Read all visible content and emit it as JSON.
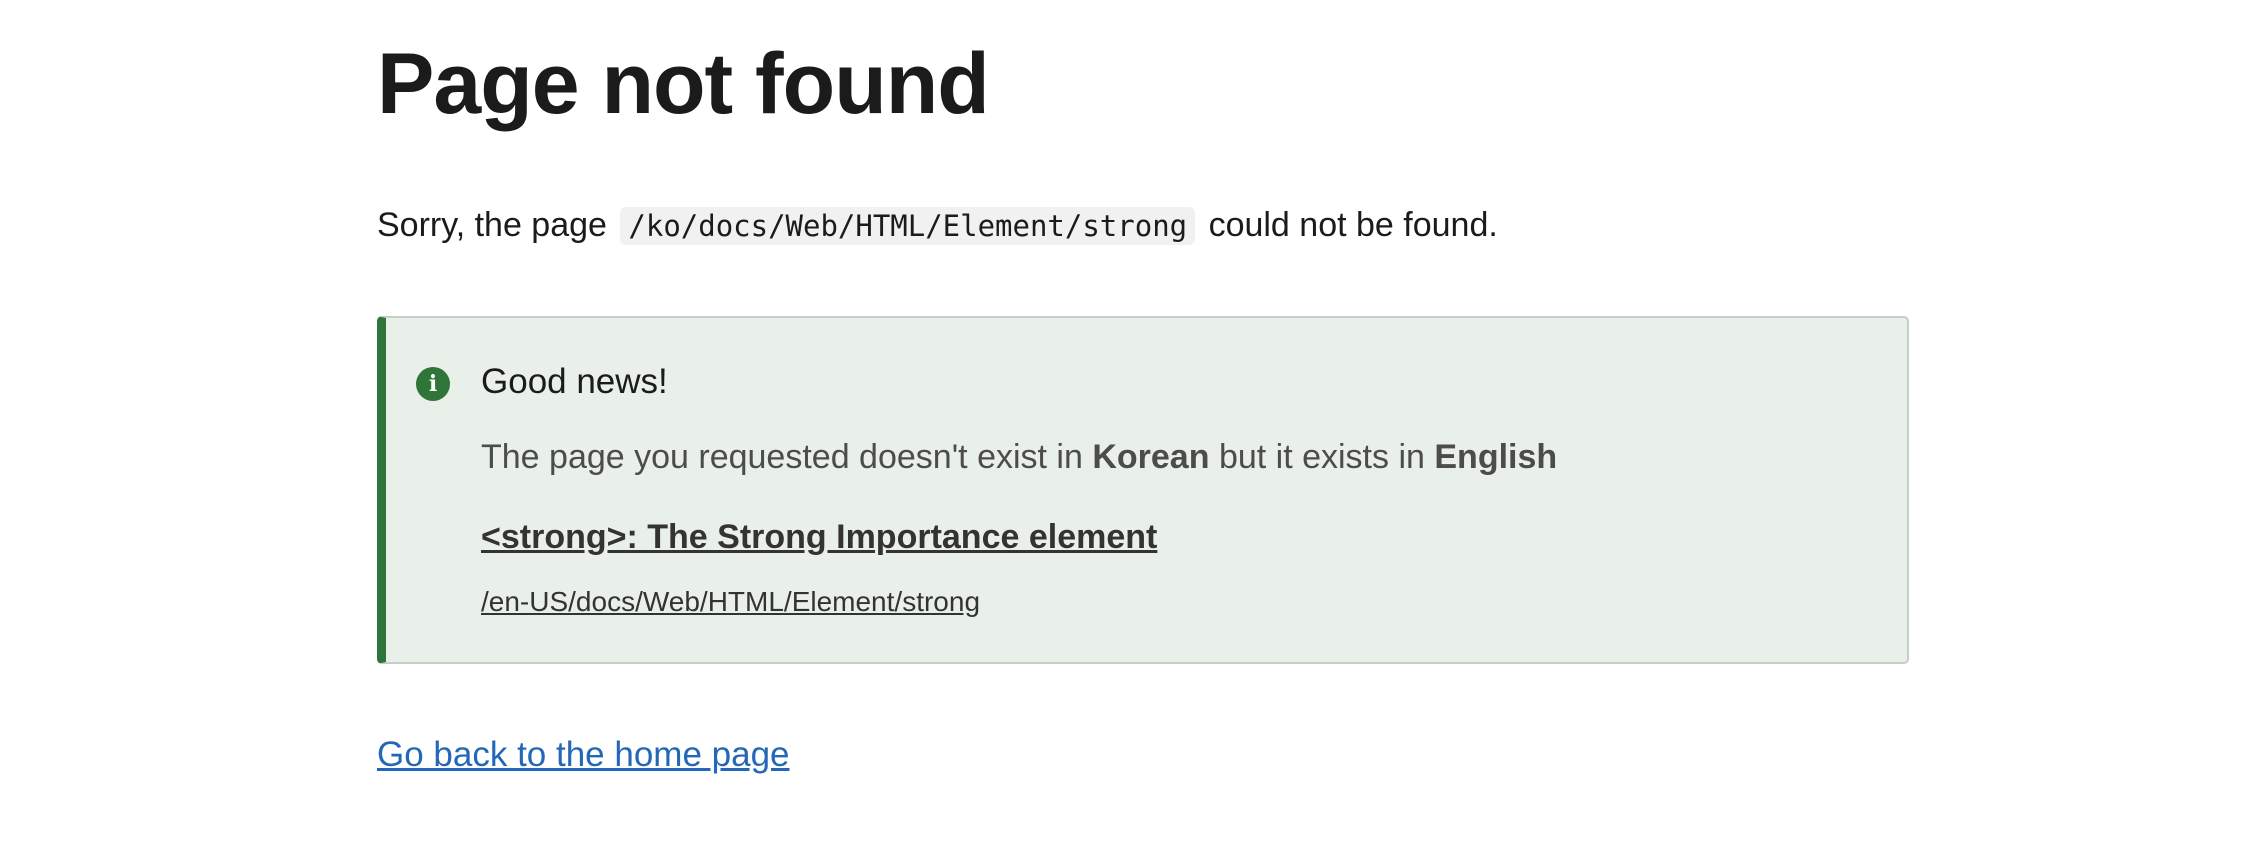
{
  "page": {
    "title": "Page not found",
    "sorry_prefix": "Sorry, the page",
    "requested_path": "/ko/docs/Web/HTML/Element/strong",
    "sorry_suffix": "could not be found."
  },
  "notice": {
    "icon": "info-icon",
    "icon_glyph": "i",
    "accent_color": "#2f7439",
    "background_color": "#e9efe9",
    "title": "Good news!",
    "text_prefix": "The page you requested doesn't exist in",
    "requested_language": "Korean",
    "text_middle": "but it exists in",
    "available_language": "English",
    "link_title": "<strong>: The Strong Importance element",
    "link_path": "/en-US/docs/Web/HTML/Element/strong"
  },
  "home_link": {
    "label": "Go back to the home page",
    "color": "#2467b8"
  }
}
